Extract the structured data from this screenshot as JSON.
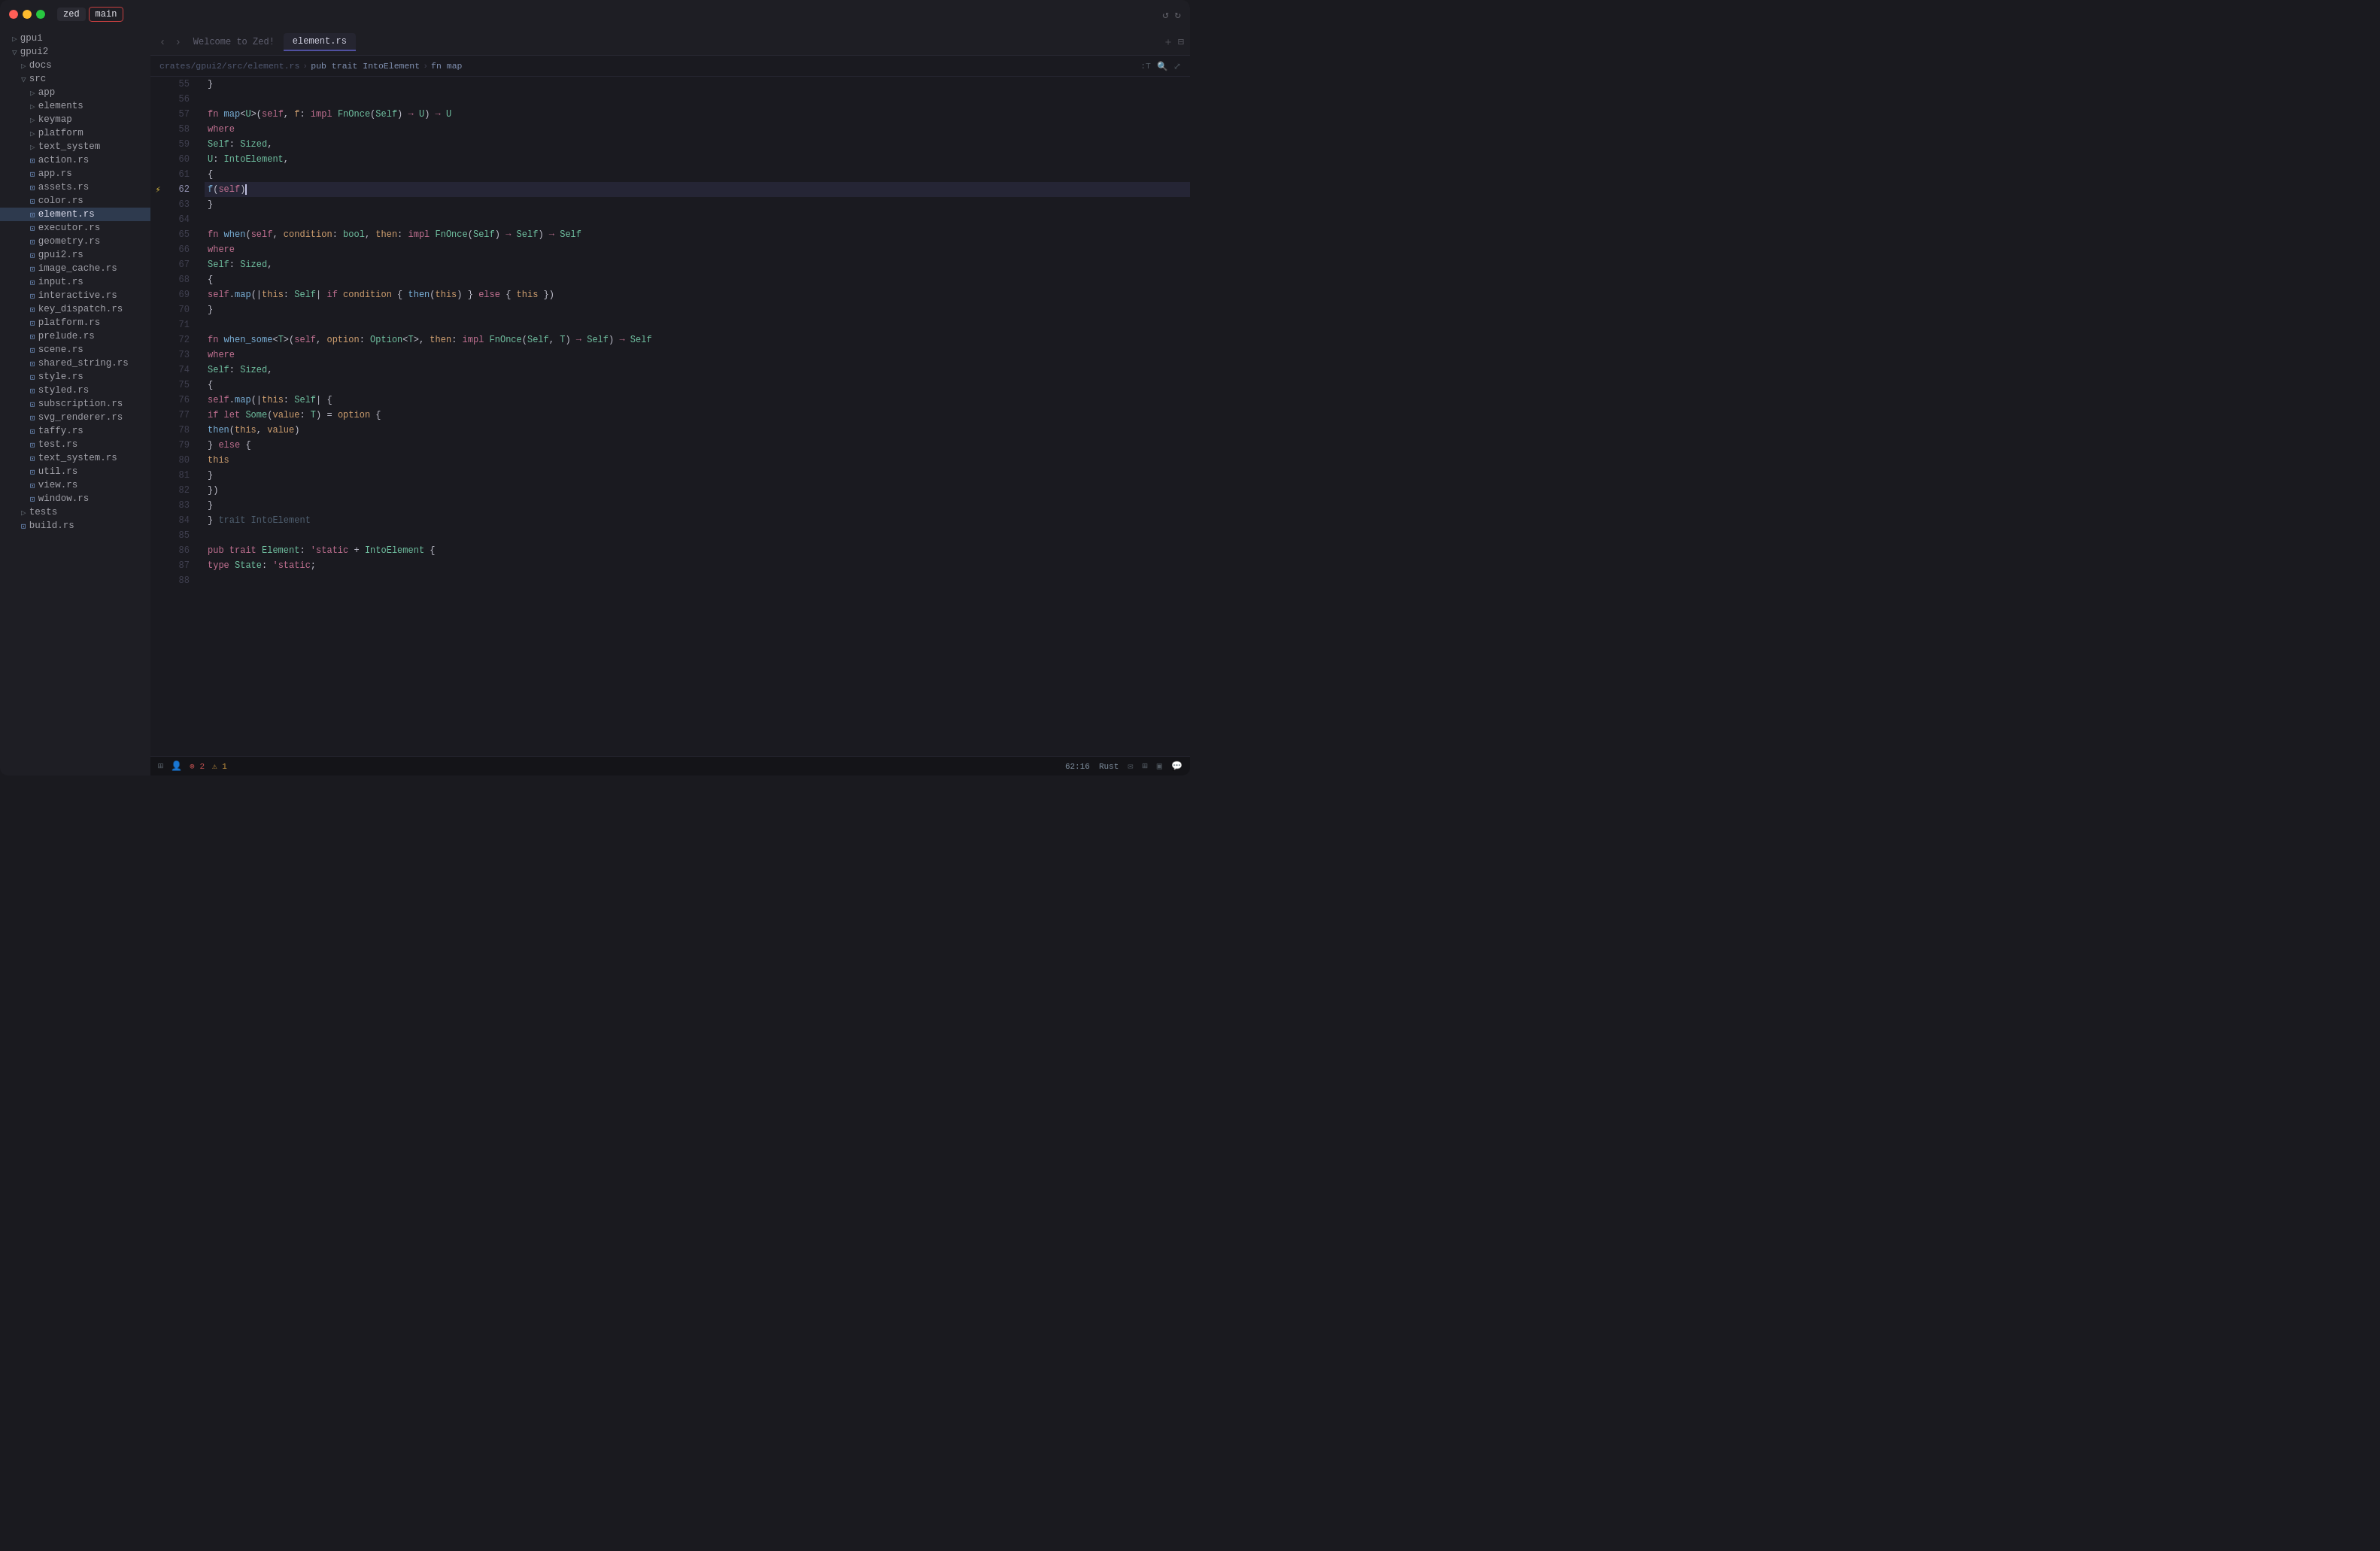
{
  "titlebar": {
    "tab_zed": "zed",
    "tab_main": "main",
    "icon_back": "⟵",
    "icon_forward": "⟶"
  },
  "editor": {
    "welcome_tab": "Welcome to Zed!",
    "active_tab": "element.rs",
    "breadcrumb": "crates/gpui2/src/element.rs > pub trait IntoElement > fn map",
    "cursor_position": "62:16",
    "language": "Rust"
  },
  "sidebar": {
    "items": [
      {
        "label": "gpui",
        "type": "folder",
        "indent": 1
      },
      {
        "label": "gpui2",
        "type": "folder",
        "indent": 1
      },
      {
        "label": "docs",
        "type": "folder",
        "indent": 2
      },
      {
        "label": "src",
        "type": "folder",
        "indent": 2
      },
      {
        "label": "app",
        "type": "folder",
        "indent": 3
      },
      {
        "label": "elements",
        "type": "folder",
        "indent": 3
      },
      {
        "label": "keymap",
        "type": "folder",
        "indent": 3
      },
      {
        "label": "platform",
        "type": "folder",
        "indent": 3
      },
      {
        "label": "text_system",
        "type": "folder",
        "indent": 3
      },
      {
        "label": "action.rs",
        "type": "file",
        "indent": 3
      },
      {
        "label": "app.rs",
        "type": "file",
        "indent": 3
      },
      {
        "label": "assets.rs",
        "type": "file",
        "indent": 3
      },
      {
        "label": "color.rs",
        "type": "file",
        "indent": 3
      },
      {
        "label": "element.rs",
        "type": "file",
        "indent": 3,
        "active": true
      },
      {
        "label": "executor.rs",
        "type": "file",
        "indent": 3
      },
      {
        "label": "geometry.rs",
        "type": "file",
        "indent": 3
      },
      {
        "label": "gpui2.rs",
        "type": "file",
        "indent": 3
      },
      {
        "label": "image_cache.rs",
        "type": "file",
        "indent": 3
      },
      {
        "label": "input.rs",
        "type": "file",
        "indent": 3
      },
      {
        "label": "interactive.rs",
        "type": "file",
        "indent": 3
      },
      {
        "label": "key_dispatch.rs",
        "type": "file",
        "indent": 3
      },
      {
        "label": "platform.rs",
        "type": "file",
        "indent": 3
      },
      {
        "label": "prelude.rs",
        "type": "file",
        "indent": 3
      },
      {
        "label": "scene.rs",
        "type": "file",
        "indent": 3
      },
      {
        "label": "shared_string.rs",
        "type": "file",
        "indent": 3
      },
      {
        "label": "style.rs",
        "type": "file",
        "indent": 3
      },
      {
        "label": "styled.rs",
        "type": "file",
        "indent": 3
      },
      {
        "label": "subscription.rs",
        "type": "file",
        "indent": 3
      },
      {
        "label": "svg_renderer.rs",
        "type": "file",
        "indent": 3
      },
      {
        "label": "taffy.rs",
        "type": "file",
        "indent": 3
      },
      {
        "label": "test.rs",
        "type": "file",
        "indent": 3
      },
      {
        "label": "text_system.rs",
        "type": "file",
        "indent": 3
      },
      {
        "label": "util.rs",
        "type": "file",
        "indent": 3
      },
      {
        "label": "view.rs",
        "type": "file",
        "indent": 3
      },
      {
        "label": "window.rs",
        "type": "file",
        "indent": 3
      },
      {
        "label": "tests",
        "type": "folder",
        "indent": 2
      },
      {
        "label": "build.rs",
        "type": "file",
        "indent": 2
      }
    ]
  },
  "code": {
    "lines": [
      {
        "num": 55,
        "content": "    }"
      },
      {
        "num": 56,
        "content": ""
      },
      {
        "num": 57,
        "content": "    fn map<U>(self, f: impl FnOnce(Self) → U) → U"
      },
      {
        "num": 58,
        "content": "    where"
      },
      {
        "num": 59,
        "content": "        Self: Sized,"
      },
      {
        "num": 60,
        "content": "        U: IntoElement,"
      },
      {
        "num": 61,
        "content": "    {"
      },
      {
        "num": 62,
        "content": "        f(self)",
        "active": true,
        "cursor_after": "f(self)"
      },
      {
        "num": 63,
        "content": "    }"
      },
      {
        "num": 64,
        "content": ""
      },
      {
        "num": 65,
        "content": "    fn when(self, condition: bool, then: impl FnOnce(Self) → Self) → Self"
      },
      {
        "num": 66,
        "content": "    where"
      },
      {
        "num": 67,
        "content": "        Self: Sized,"
      },
      {
        "num": 68,
        "content": "    {"
      },
      {
        "num": 69,
        "content": "        self.map(|this: Self| if condition { then(this) } else { this })"
      },
      {
        "num": 70,
        "content": "    }"
      },
      {
        "num": 71,
        "content": ""
      },
      {
        "num": 72,
        "content": "    fn when_some<T>(self, option: Option<T>, then: impl FnOnce(Self, T) → Self) → Self"
      },
      {
        "num": 73,
        "content": "    where"
      },
      {
        "num": 74,
        "content": "        Self: Sized,"
      },
      {
        "num": 75,
        "content": "    {"
      },
      {
        "num": 76,
        "content": "        self.map(|this: Self| {"
      },
      {
        "num": 77,
        "content": "            if let Some(value: T) = option {"
      },
      {
        "num": 78,
        "content": "                then(this, value)"
      },
      {
        "num": 79,
        "content": "            } else {"
      },
      {
        "num": 80,
        "content": "                this"
      },
      {
        "num": 81,
        "content": "            }"
      },
      {
        "num": 82,
        "content": "        })"
      },
      {
        "num": 83,
        "content": "    }"
      },
      {
        "num": 84,
        "content": "} trait IntoElement"
      },
      {
        "num": 85,
        "content": ""
      },
      {
        "num": 86,
        "content": "pub trait Element: 'static + IntoElement {"
      },
      {
        "num": 87,
        "content": "    type State: 'static;"
      },
      {
        "num": 88,
        "content": ""
      }
    ]
  },
  "statusbar": {
    "errors": "2",
    "warnings": "1",
    "cursor_position": "62:16",
    "language": "Rust"
  }
}
